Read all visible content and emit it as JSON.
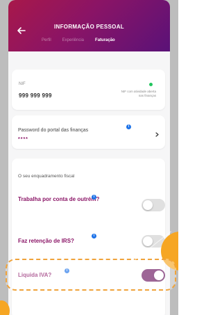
{
  "header": {
    "title": "INFORMAÇÃO PESSOAL",
    "tabs": [
      "Perfil",
      "Experiência",
      "Faturação"
    ],
    "active_tab": "Faturação"
  },
  "nif": {
    "label": "NIF",
    "value": "999 999 999",
    "status_text": "NIF com atividade aberta nas finanças",
    "status_color": "#22c55e"
  },
  "password": {
    "label": "Password do portal das finanças",
    "value": "****"
  },
  "fiscal": {
    "section_title": "O seu enquadramento fiscal",
    "items": [
      {
        "label": "Trabalha por conta de outrém?",
        "enabled": false
      },
      {
        "label": "Faz retenção de IRS?",
        "enabled": false
      },
      {
        "label": "Liquida IVA?",
        "enabled": true
      }
    ]
  },
  "info_marker": "i",
  "colors": {
    "brand_start": "#a8184a",
    "brand_end": "#5a1278",
    "accent": "#8a1466",
    "toggle_on": "#6a1460",
    "info": "#1e73e8",
    "highlight": "#f0a33b"
  }
}
